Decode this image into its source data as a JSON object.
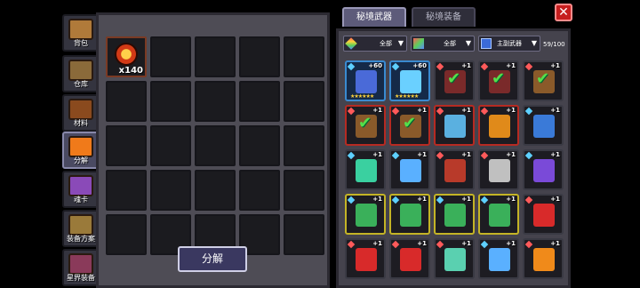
{
  "side_tabs": [
    {
      "label": "背包",
      "icon": "backpack-chest-icon",
      "color": "#b07a3a",
      "active": false
    },
    {
      "label": "仓库",
      "icon": "warehouse-chest-icon",
      "color": "#8a6a3a",
      "active": false
    },
    {
      "label": "材料",
      "icon": "materials-book-icon",
      "color": "#8a4a1e",
      "active": false
    },
    {
      "label": "分解",
      "icon": "decompose-cauldron-icon",
      "color": "#f07a1a",
      "active": true
    },
    {
      "label": "魂卡",
      "icon": "soul-card-icon",
      "color": "#8a4ab8",
      "active": false
    },
    {
      "label": "装备方案",
      "icon": "equipment-plan-icon",
      "color": "#9a7a3a",
      "active": false
    },
    {
      "label": "星界装备",
      "icon": "astral-equipment-icon",
      "color": "#8a3a5a",
      "active": false
    }
  ],
  "decompose": {
    "slots": [
      {
        "qty": "x140",
        "item": "red-gem-material-icon"
      }
    ],
    "button_label": "分解"
  },
  "tabs": {
    "secret_weapons": "秘境武器",
    "secret_equipment": "秘境装备"
  },
  "filters": {
    "quality": "全部",
    "element": "全部",
    "weapon_type": "主副武器"
  },
  "slot_count": "59/100",
  "weapons": [
    {
      "border": "blue",
      "gem": "blue",
      "plus": "+60",
      "stars": "★★★★★★",
      "art": "#4a6ad8",
      "icon": "dark-warrior-weapon-icon"
    },
    {
      "border": "blue",
      "gem": "blue",
      "plus": "+60",
      "stars": "★★★★★★",
      "art": "#6ad0ff",
      "icon": "ice-crystal-weapon-icon"
    },
    {
      "border": "dark",
      "gem": "red",
      "plus": "+1",
      "check": true,
      "art": "#7a2a2a",
      "icon": "red-sword-icon"
    },
    {
      "border": "dark",
      "gem": "red",
      "plus": "+1",
      "check": true,
      "art": "#7a2a2a",
      "icon": "red-sword-icon"
    },
    {
      "border": "dark",
      "gem": "red",
      "plus": "+1",
      "check": true,
      "art": "#8a5a2a",
      "icon": "bronze-sword-icon"
    },
    {
      "border": "red",
      "gem": "red",
      "plus": "+1",
      "check": true,
      "art": "#8a5a2a",
      "icon": "bronze-sword-icon"
    },
    {
      "border": "red",
      "gem": "red",
      "plus": "+1",
      "check": true,
      "art": "#8a5a2a",
      "icon": "bronze-sword-icon"
    },
    {
      "border": "red",
      "gem": "red",
      "plus": "+1",
      "art": "#5ab0e0",
      "icon": "ice-staff-icon"
    },
    {
      "border": "red",
      "gem": "red",
      "plus": "+1",
      "art": "#e08a1a",
      "icon": "flame-blade-icon"
    },
    {
      "border": "dark",
      "gem": "blue",
      "plus": "+1",
      "art": "#3a7ad8",
      "icon": "blue-cross-spear-icon"
    },
    {
      "border": "dark",
      "gem": "blue",
      "plus": "+1",
      "art": "#3ad0a0",
      "icon": "teal-serpent-icon"
    },
    {
      "border": "dark",
      "gem": "blue",
      "plus": "+1",
      "art": "#5ab0ff",
      "icon": "crystal-staff-icon"
    },
    {
      "border": "dark",
      "gem": "red",
      "plus": "+1",
      "art": "#b83a2a",
      "icon": "ruby-staff-icon"
    },
    {
      "border": "dark",
      "gem": "red",
      "plus": "+1",
      "art": "#c0c0c0",
      "icon": "silver-axe-icon"
    },
    {
      "border": "dark",
      "gem": "blue",
      "plus": "+1",
      "art": "#7a4ad8",
      "icon": "purple-tome-icon"
    },
    {
      "border": "yellow",
      "gem": "blue",
      "plus": "+1",
      "art": "#3ab05a",
      "icon": "green-crab-icon"
    },
    {
      "border": "yellow",
      "gem": "blue",
      "plus": "+1",
      "art": "#3ab05a",
      "icon": "green-crab-icon"
    },
    {
      "border": "yellow",
      "gem": "blue",
      "plus": "+1",
      "art": "#3ab05a",
      "icon": "green-crab-icon"
    },
    {
      "border": "yellow",
      "gem": "blue",
      "plus": "+1",
      "art": "#3ab05a",
      "icon": "green-crab-icon"
    },
    {
      "border": "dark",
      "gem": "red",
      "plus": "+1",
      "art": "#d82a2a",
      "icon": "red-hook-icon"
    },
    {
      "border": "dark",
      "gem": "red",
      "plus": "+1",
      "art": "#d82a2a",
      "icon": "red-ring-icon"
    },
    {
      "border": "dark",
      "gem": "red",
      "plus": "+1",
      "art": "#d82a2a",
      "icon": "red-ring-icon"
    },
    {
      "border": "dark",
      "gem": "red",
      "plus": "+1",
      "art": "#5ad0b0",
      "icon": "teal-beast-icon"
    },
    {
      "border": "dark",
      "gem": "blue",
      "plus": "+1",
      "art": "#5ab0ff",
      "icon": "ice-shard-icon"
    },
    {
      "border": "dark",
      "gem": "red",
      "plus": "+1",
      "art": "#f08a1a",
      "icon": "fire-crown-icon"
    }
  ],
  "colors": {
    "close": "#c61e1e",
    "check": "#55e04a",
    "border_blue": "#3a8ad0",
    "border_red": "#b62a22",
    "border_yellow": "#c4b426"
  }
}
